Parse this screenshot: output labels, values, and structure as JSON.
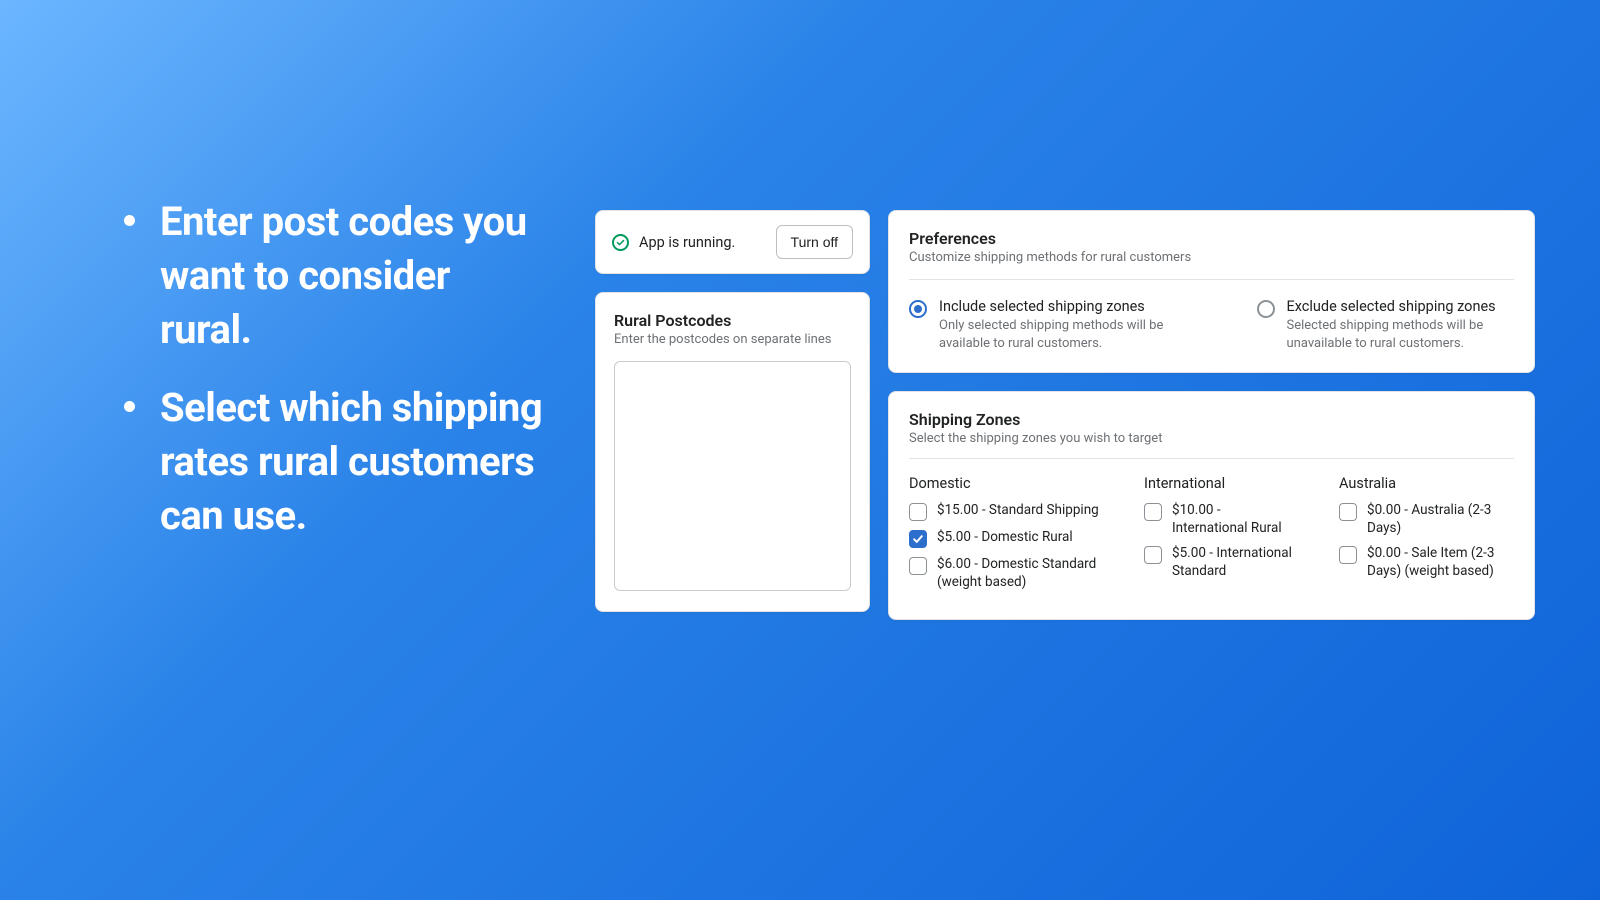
{
  "promo": {
    "bullets": [
      "Enter post codes you want to consider rural.",
      "Select which shipping rates rural customers can use."
    ]
  },
  "status": {
    "text": "App is running.",
    "button": "Turn off"
  },
  "postcodes": {
    "title": "Rural Postcodes",
    "subtitle": "Enter the postcodes on separate lines",
    "value": ""
  },
  "preferences": {
    "title": "Preferences",
    "subtitle": "Customize shipping methods for rural customers",
    "options": [
      {
        "label": "Include selected shipping zones",
        "desc": "Only selected shipping methods will be available to rural customers.",
        "checked": true
      },
      {
        "label": "Exclude selected shipping zones",
        "desc": "Selected shipping methods will be unavailable to rural customers.",
        "checked": false
      }
    ]
  },
  "zones": {
    "title": "Shipping Zones",
    "subtitle": "Select the shipping zones you wish to target",
    "columns": [
      {
        "name": "Domestic",
        "rates": [
          {
            "label": "$15.00 - Standard Shipping",
            "checked": false
          },
          {
            "label": "$5.00 - Domestic Rural",
            "checked": true
          },
          {
            "label": "$6.00 - Domestic Standard (weight based)",
            "checked": false
          }
        ]
      },
      {
        "name": "International",
        "rates": [
          {
            "label": "$10.00 - International Rural",
            "checked": false
          },
          {
            "label": "$5.00 - International Standard",
            "checked": false
          }
        ]
      },
      {
        "name": "Australia",
        "rates": [
          {
            "label": "$0.00 - Australia (2-3 Days)",
            "checked": false
          },
          {
            "label": "$0.00 - Sale Item (2-3 Days) (weight based)",
            "checked": false
          }
        ]
      }
    ]
  }
}
